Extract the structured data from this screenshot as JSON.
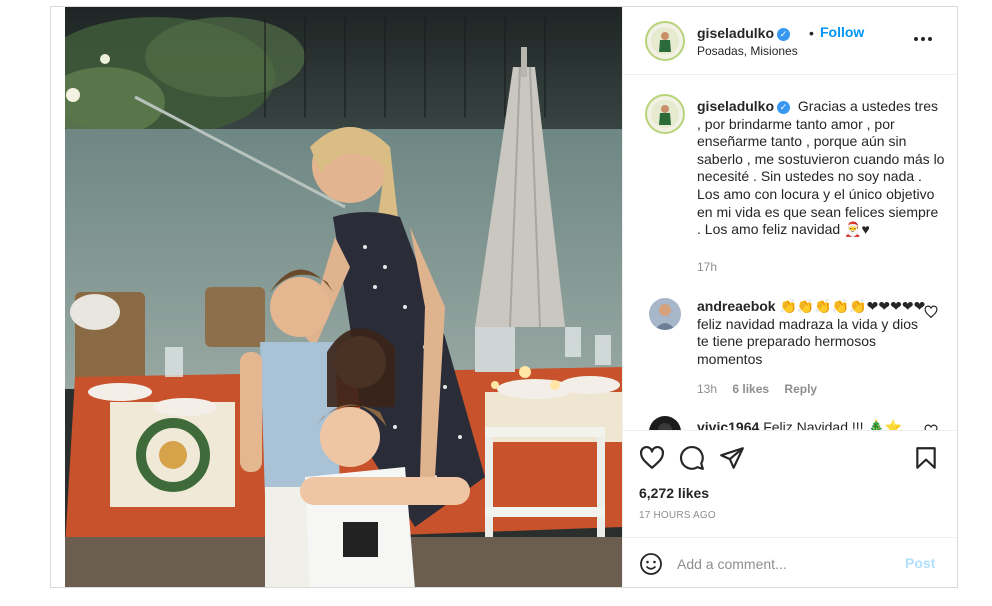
{
  "header": {
    "username": "giseladulko",
    "dot": "•",
    "follow_label": "Follow",
    "location": "Posadas, Misiones",
    "more_label": "..."
  },
  "caption": {
    "username": "giseladulko",
    "text": "Gracias a ustedes tres , por brindarme tanto amor , por enseñarme tanto , porque aún sin saberlo , me sostuvieron cuando más lo necesité . Sin ustedes no soy nada . Los amo con locura y el único objetivo en mi vida es que sean felices siempre . Los amo feliz navidad 🎅♥",
    "time": "17h"
  },
  "comments": [
    {
      "username": "andreaebok",
      "text": "👏👏👏👏👏❤❤❤❤❤feliz navidad madraza la vida y dios te tiene preparado hermosos momentos",
      "time": "13h",
      "likes": "6 likes",
      "reply_label": "Reply"
    },
    {
      "username": "vivic1964",
      "text": "Feliz Navidad !!! 🎄⭐"
    }
  ],
  "stats": {
    "likes": "6,272 likes",
    "ago": "17 HOURS AGO"
  },
  "add_comment": {
    "placeholder": "Add a comment...",
    "post_label": "Post"
  },
  "icons": [
    "verified-icon",
    "more-icon",
    "heart-icon",
    "comment-icon",
    "share-icon",
    "bookmark-icon",
    "emoji-icon"
  ],
  "colors": {
    "link_blue": "#0095f6",
    "verified_blue": "#3897f0",
    "post_disabled": "#b2dffc",
    "meta_gray": "#8e8e8e"
  }
}
